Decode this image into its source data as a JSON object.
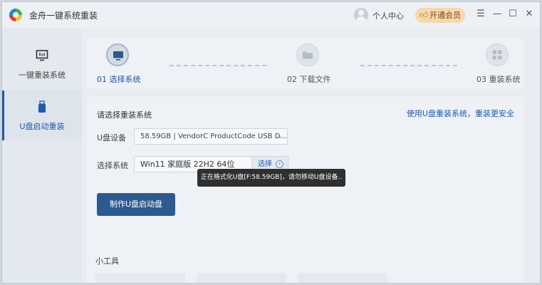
{
  "app": {
    "title": "金舟一键系统重装",
    "user_center": "个人中心",
    "vip_button": "开通会员"
  },
  "icons": {
    "logo": "app-logo-icon",
    "user": "user-avatar-icon",
    "vip": "thumbs-up-icon",
    "menu": "menu-icon",
    "minimize": "minimize-icon",
    "maximize": "maximize-icon",
    "close": "close-icon",
    "reinstall": "monitor-icon",
    "usb": "usb-drive-icon",
    "step_select": "monitor-icon",
    "step_download": "folder-icon",
    "step_reinstall": "grid-icon",
    "choose_arrow": "circle-arrow-right-icon"
  },
  "sidebar": {
    "items": [
      {
        "label": "一键重装系统",
        "active": false
      },
      {
        "label": "U盘启动重装",
        "active": true
      }
    ]
  },
  "steps": [
    {
      "label": "01 选择系统",
      "active": true
    },
    {
      "label": "02 下载文件",
      "active": false
    },
    {
      "label": "03 重装系统",
      "active": false
    }
  ],
  "main": {
    "section_title": "请选择重装系统",
    "safe_link": "使用U盘重装系统，重装更安全",
    "udisk_label": "U盘设备",
    "udisk_value": "58.59GB | VendorC ProductCode USB D...",
    "system_label": "选择系统",
    "system_value": "Win11 家庭版 22H2 64位",
    "choose_button": "选择",
    "make_button": "制作U盘启动盘",
    "tools_title": "小工具"
  },
  "toast": {
    "text": "正在格式化U盘[F:58.59GB]，请勿移动U盘设备.."
  },
  "colors": {
    "accent": "#1e5aa8",
    "primary_button": "#2d5a8e",
    "vip_bg": "#f5d8ad",
    "toast_bg": "#2f2f2f"
  }
}
